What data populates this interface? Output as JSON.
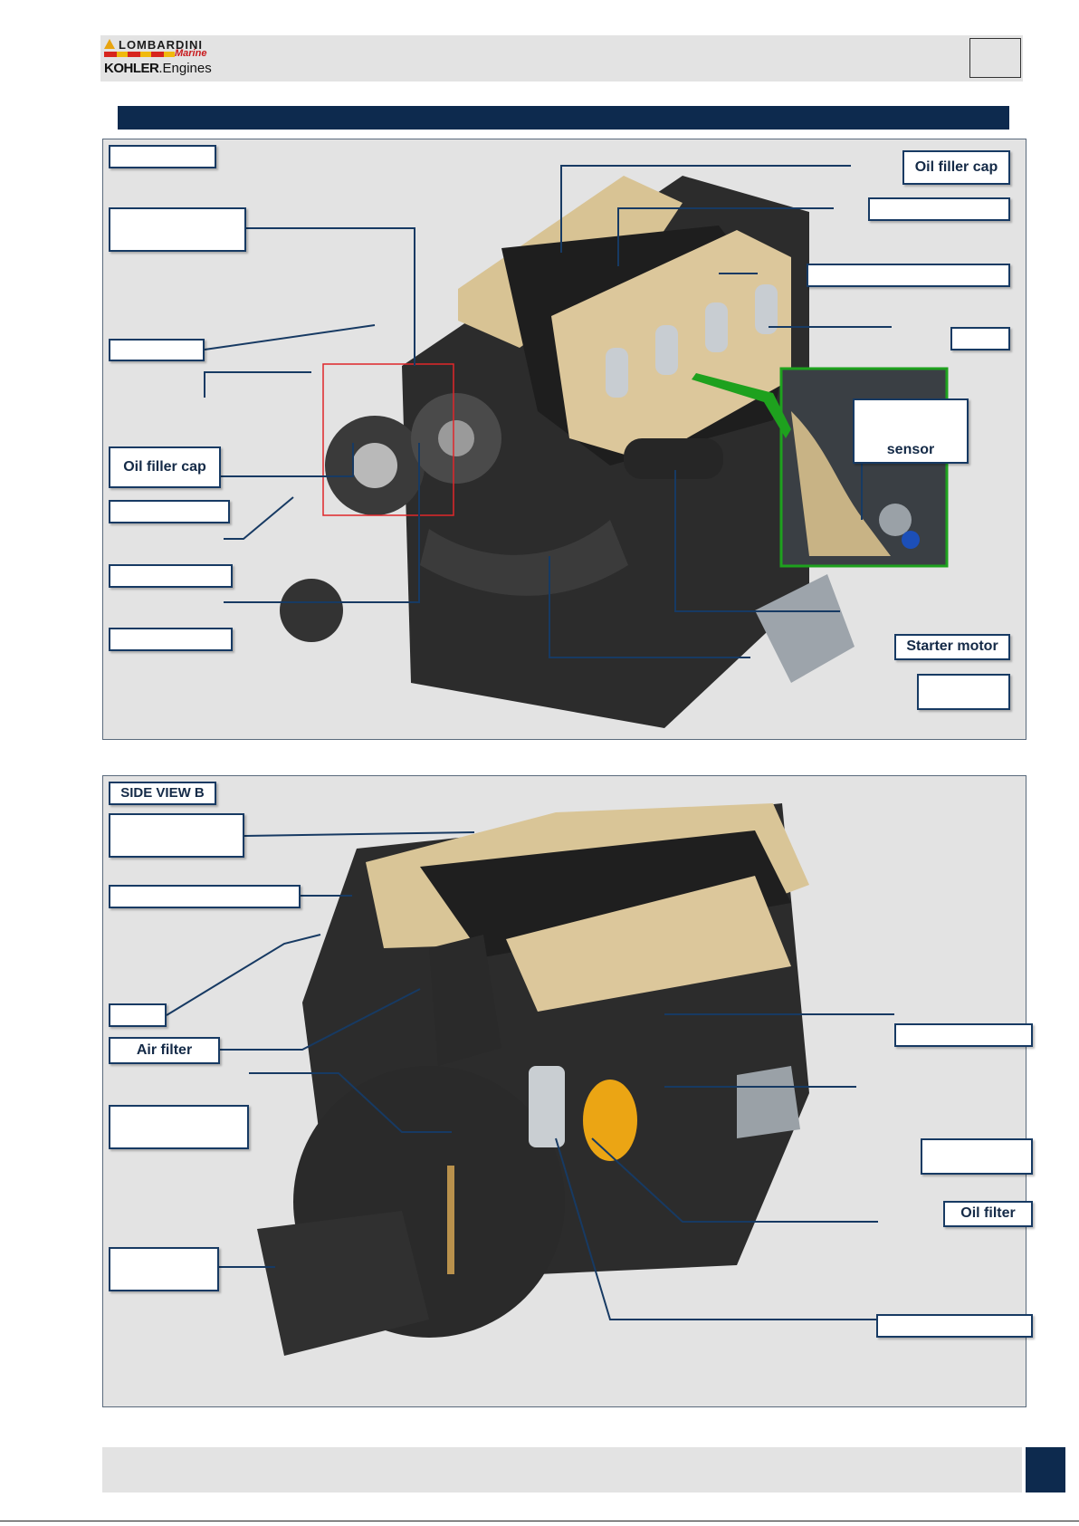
{
  "header": {
    "brand": {
      "lombardini": "LOMBARDINI",
      "marine": "Marine",
      "kohler_bold": "KOHLER",
      "kohler_rest": ".Engines"
    },
    "page_box": "",
    "title": ""
  },
  "panel_a": {
    "view_label": "",
    "callouts": {
      "top_left": "",
      "mid_left": "",
      "oil_filler_cap_left": "Oil  filler cap",
      "pulley_left": "",
      "pump_left": "",
      "belt_left": "",
      "oil_filler_cap_top": "Oil filler cap",
      "right_2": "",
      "right_3": "",
      "right_4": "",
      "inset_label_top": "",
      "inset_label_sensor": "sensor",
      "starter_motor": "Starter motor",
      "right_bottom": ""
    },
    "colors": {
      "inset_border": "#1ea11e",
      "highlight_box": "#e0262a"
    }
  },
  "panel_b": {
    "view_label": "SIDE VIEW B",
    "callouts": {
      "top_left": "",
      "left_2": "",
      "left_3": "",
      "air_filter": "Air filter",
      "left_5": "",
      "left_6": "",
      "right_1": "",
      "right_2": "",
      "oil_filter": "Oil filter",
      "right_4": ""
    }
  },
  "footer": {
    "page_number": ""
  },
  "colors": {
    "navy": "#0d2a4e",
    "panel_bg": "#e3e3e3",
    "tag_border": "#173a63"
  },
  "icons": [
    "engine-illustration",
    "logo-triangle"
  ]
}
